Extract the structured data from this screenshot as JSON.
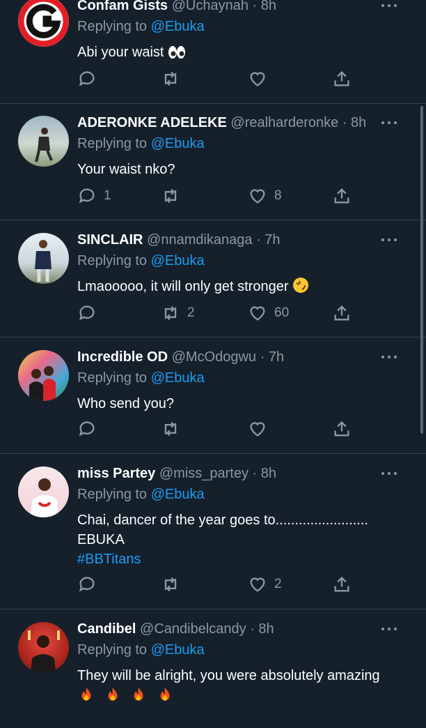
{
  "replying_to_label": "Replying to",
  "tweets": [
    {
      "name": "Confam Gists",
      "handle": "@Uchaynah",
      "time": "· 8h",
      "mention": "@Ebuka",
      "text": "Abi your waist",
      "emoji_after": "eyes-emoji",
      "reply_count": "",
      "retweet_count": "",
      "like_count": ""
    },
    {
      "name": "ADERONKE ADELEKE",
      "handle": "@realharderonke",
      "time": "· 8h",
      "mention": "@Ebuka",
      "text": "Your waist nko?",
      "reply_count": "1",
      "retweet_count": "",
      "like_count": "8"
    },
    {
      "name": "SINCLAIR",
      "handle": "@nnamdikanaga",
      "time": "· 7h",
      "mention": "@Ebuka",
      "text": "Lmaooooo, it will only get stronger",
      "emoji_after": "rolling-laughing-emoji",
      "reply_count": "",
      "retweet_count": "2",
      "like_count": "60"
    },
    {
      "name": "Incredible OD",
      "handle": "@McOdogwu",
      "time": "· 7h",
      "mention": "@Ebuka",
      "text": "Who send you?",
      "reply_count": "",
      "retweet_count": "",
      "like_count": ""
    },
    {
      "name": "miss Partey",
      "handle": "@miss_partey",
      "time": "· 8h",
      "mention": "@Ebuka",
      "text_line1": "Chai, dancer of the year goes to........................",
      "text_line2": "EBUKA",
      "hashtag": "#BBTitans",
      "reply_count": "",
      "retweet_count": "",
      "like_count": "2"
    },
    {
      "name": "Candibel",
      "handle": "@Candibelcandy",
      "time": "· 8h",
      "mention": "@Ebuka",
      "text": "They will be alright, you were absolutely amazing",
      "emoji_line": "fire-emoji x4"
    }
  ],
  "colors": {
    "background": "#15202b",
    "secondary_text": "#8b98a5",
    "accent": "#1d9bf0",
    "divider": "#38444d"
  }
}
